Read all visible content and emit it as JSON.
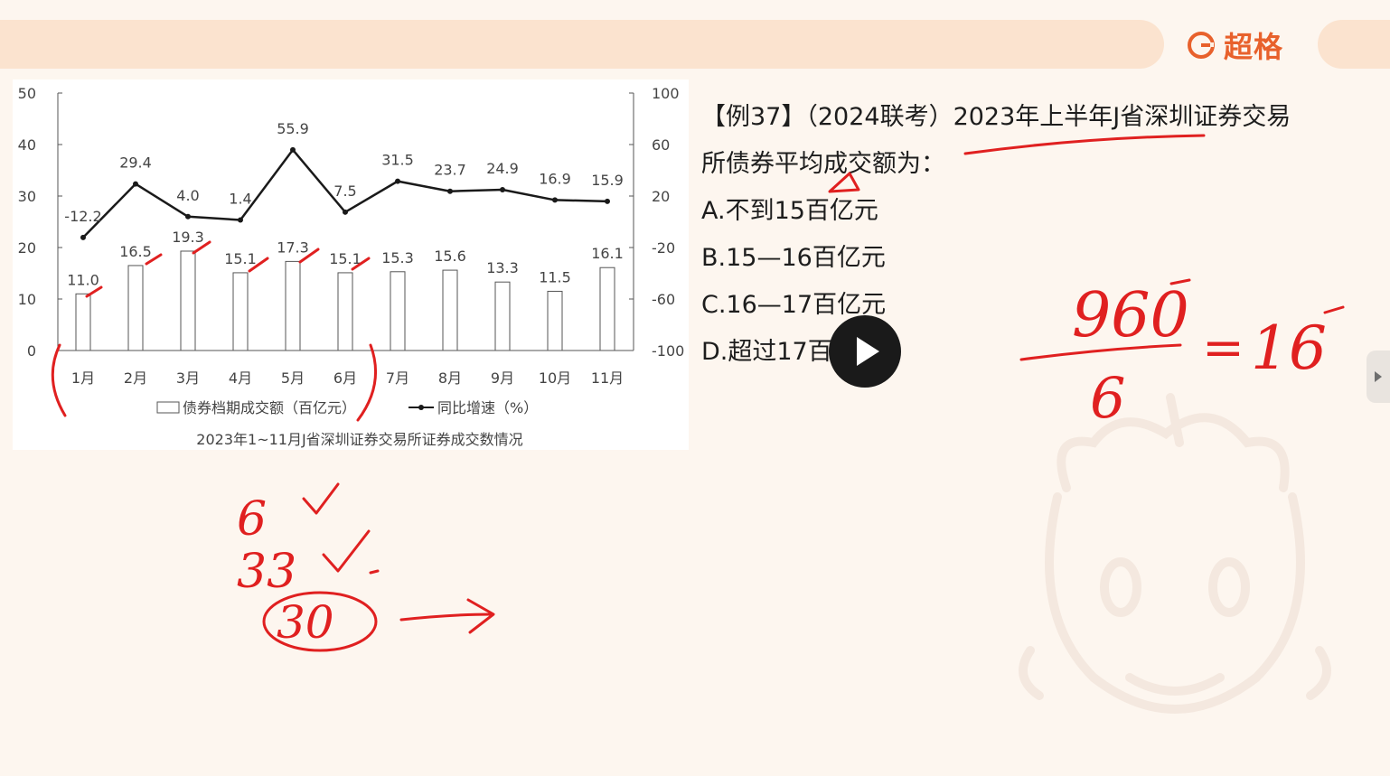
{
  "brand": {
    "name": "超格",
    "color": "#e8612c",
    "icon": "brand-logo-icon"
  },
  "chart_data": {
    "type": "bar",
    "title": "2023年1~11月J省深圳证券交易所证券成交数情况",
    "categories": [
      "1月",
      "2月",
      "3月",
      "4月",
      "5月",
      "6月",
      "7月",
      "8月",
      "9月",
      "10月",
      "11月"
    ],
    "series": [
      {
        "name": "债券档期成交额（百亿元）",
        "kind": "bar",
        "axis": "left",
        "values": [
          11.0,
          16.5,
          19.3,
          15.1,
          17.3,
          15.1,
          15.3,
          15.6,
          13.3,
          11.5,
          16.1
        ],
        "labels": [
          "11.0",
          "16.5",
          "19.3",
          "15.1",
          "17.3",
          "15.1",
          "15.3",
          "15.6",
          "13.3",
          "11.5",
          "16.1"
        ]
      },
      {
        "name": "同比增速（%）",
        "kind": "line",
        "axis": "right",
        "values": [
          -12.2,
          29.4,
          4.0,
          1.4,
          55.9,
          7.5,
          31.5,
          23.7,
          24.9,
          16.9,
          15.9
        ],
        "labels": [
          "-12.2",
          "29.4",
          "4.0",
          "1.4",
          "55.9",
          "7.5",
          "31.5",
          "23.7",
          "24.9",
          "16.9",
          "15.9"
        ]
      }
    ],
    "y_left": {
      "range": [
        0,
        50
      ],
      "ticks": [
        "0",
        "10",
        "20",
        "30",
        "40",
        "50"
      ]
    },
    "y_right": {
      "range": [
        -100,
        100
      ],
      "ticks": [
        "-100",
        "-60",
        "-20",
        "20",
        "60",
        "100"
      ]
    },
    "legend": {
      "placement": "bottom"
    },
    "grid": false
  },
  "question": {
    "stem_line1": "【例37】（2024联考）2023年上半年J省深圳证券交易",
    "stem_line2": "所债券平均成交额为：",
    "options": [
      "A.不到15百亿元",
      "B.15—16百亿元",
      "C.16—17百亿元",
      "D.超过17百亿元"
    ]
  },
  "annotations": {
    "fraction_numerator": "960",
    "fraction_denominator": "6",
    "equals": "=",
    "result": "16",
    "note_6": "6",
    "note_33": "33",
    "note_30": "30",
    "ink_color": "#e02020"
  },
  "player": {
    "play_icon": "play-icon",
    "side_tab_icon": "chevron-right-icon"
  }
}
